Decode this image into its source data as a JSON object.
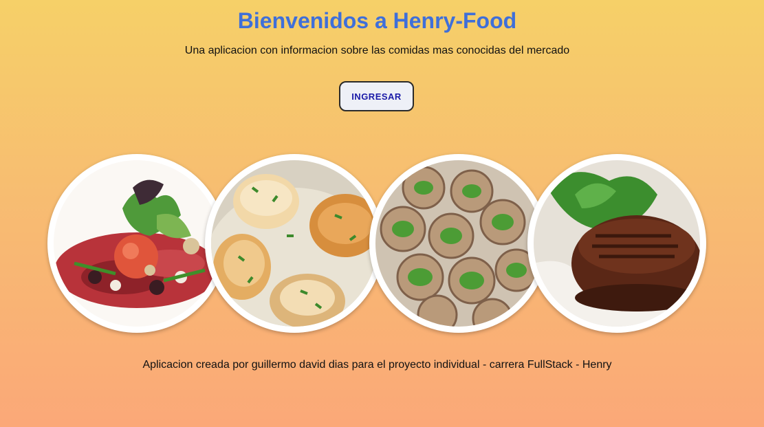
{
  "header": {
    "title": "Bienvenidos a Henry-Food",
    "subtitle": "Una aplicacion con informacion sobre las comidas mas conocidas del mercado"
  },
  "cta": {
    "label": "INGRESAR"
  },
  "gallery": {
    "dishes": [
      {
        "name": "carpaccio-salad"
      },
      {
        "name": "seared-scallops"
      },
      {
        "name": "escargots"
      },
      {
        "name": "filet-steak"
      }
    ]
  },
  "footer": {
    "text": "Aplicacion creada por guillermo david dias para el proyecto individual - carrera FullStack - Henry"
  },
  "colors": {
    "title": "#3f6fd9",
    "button_text": "#1a1aa8",
    "bg_top": "#f6d068",
    "bg_bottom": "#fba878"
  }
}
